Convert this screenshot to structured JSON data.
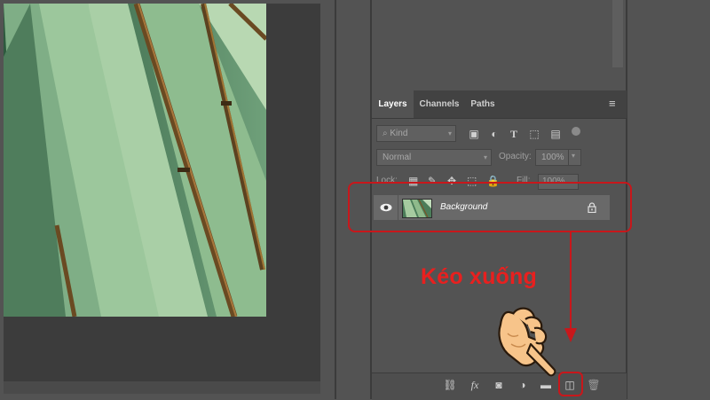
{
  "tabs": [
    {
      "label": "Layers"
    },
    {
      "label": "Channels"
    },
    {
      "label": "Paths"
    }
  ],
  "filter": {
    "kind_label": "Kind",
    "icons": [
      "image-filter-icon",
      "adjustment-filter-icon",
      "type-filter-icon",
      "shape-filter-icon",
      "smart-object-filter-icon",
      "filter-toggle-icon"
    ]
  },
  "blend": {
    "mode": "Normal",
    "opacity_label": "Opacity:",
    "opacity_value": "100%"
  },
  "lock": {
    "label": "Lock:",
    "fill_label": "Fill:",
    "fill_value": "100%"
  },
  "layer": {
    "name": "Background",
    "visible": true,
    "locked": true
  },
  "bottom_toolbar": {
    "icons": [
      "link-icon",
      "fx-icon",
      "mask-icon",
      "adjustment-icon",
      "folder-icon",
      "new-layer-icon",
      "trash-icon"
    ]
  },
  "annotation": {
    "text": "Kéo xuống",
    "color": "#e8201f"
  },
  "colors": {
    "panel_bg": "#535353",
    "highlight": "#c8171b",
    "layer_row": "#696969"
  }
}
